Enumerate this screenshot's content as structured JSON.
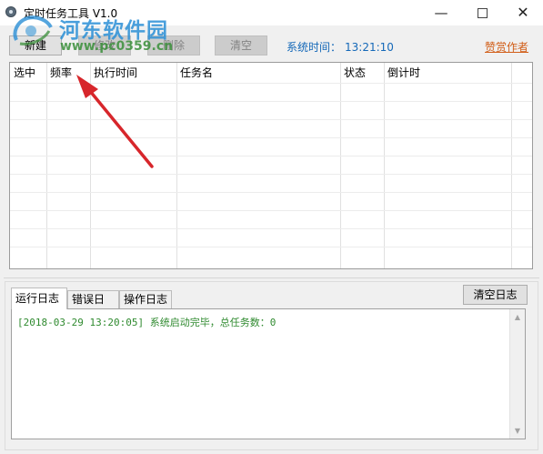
{
  "window": {
    "title": "定时任务工具 V1.0",
    "icon": "gear-clock-icon",
    "controls": {
      "minimize": "—",
      "close": "✕"
    }
  },
  "watermark": {
    "brand": "河东软件园",
    "url": "www.pc0359.cn"
  },
  "toolbar": {
    "new_label": "新建",
    "edit_label": "修改",
    "delete_label": "删除",
    "clear_label": "清空",
    "system_time_label": "系统时间：",
    "system_time_value": "13:21:10",
    "donate_label": "赞赏作者"
  },
  "task_table": {
    "columns": [
      "选中",
      "频率",
      "执行时间",
      "任务名",
      "状态",
      "倒计时"
    ],
    "rows": []
  },
  "log_panel": {
    "tabs": [
      "运行日志",
      "错误日志",
      "操作日志"
    ],
    "active_tab": "运行日志",
    "clear_log_label": "清空日志",
    "entries": [
      "[2018-03-29 13:20:05] 系统启动完毕，总任务数：0"
    ]
  },
  "colors": {
    "system_time": "#1468b8",
    "donate_link": "#d15d17",
    "log_text": "#2f8a2f",
    "annotation_arrow": "#d7262b"
  }
}
